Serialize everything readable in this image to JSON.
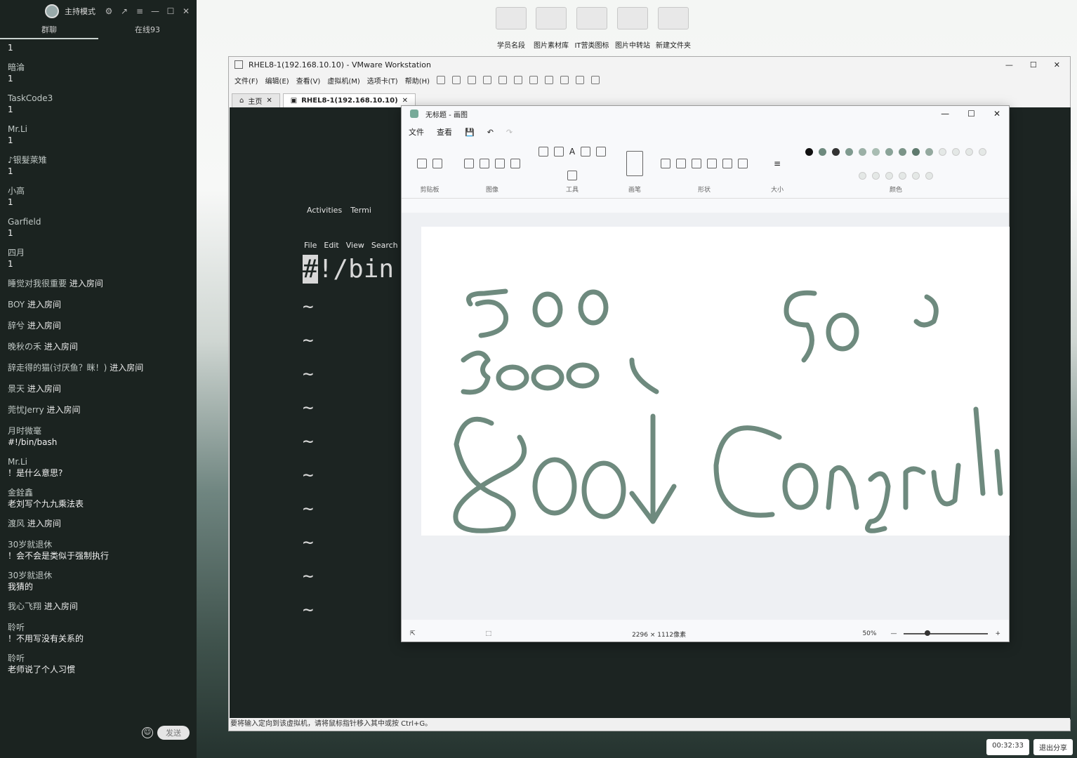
{
  "chat": {
    "mode": "主持模式",
    "tabs": [
      "群聊",
      "在线93"
    ],
    "messages": [
      {
        "who": "",
        "text": "1"
      },
      {
        "who": "暗淪",
        "text": "1"
      },
      {
        "who": "TaskCode3",
        "text": "1"
      },
      {
        "who": "Mr.Li",
        "text": "1"
      },
      {
        "who": "♪银髮萊雉",
        "text": "1"
      },
      {
        "who": "小高",
        "text": "1"
      },
      {
        "who": "Garfield",
        "text": "1"
      },
      {
        "who": "四月",
        "text": "1"
      }
    ],
    "joins": [
      {
        "who": "睡觉对我很重要",
        "action": "进入房间"
      },
      {
        "who": "BOY",
        "action": "进入房间"
      },
      {
        "who": "辞兮",
        "action": "进入房间"
      },
      {
        "who": "晚秋の禾",
        "action": "进入房间"
      },
      {
        "who": "辞走得的猫(讨厌鱼？眯！)",
        "action": "进入房间"
      },
      {
        "who": "景天",
        "action": "进入房间"
      },
      {
        "who": "莞忧Jerry",
        "action": "进入房间"
      }
    ],
    "messages2": [
      {
        "who": "月时微毫",
        "text": "#!/bin/bash"
      },
      {
        "who": "Mr.Li",
        "text": "！是什么意思?"
      },
      {
        "who": "金銓鑫",
        "text": "老刘写个九九乘法表"
      }
    ],
    "join2": {
      "who": "渡风",
      "action": "进入房间"
    },
    "messages3": [
      {
        "who": "30岁就退休",
        "text": "！会不会是类似于强制执行"
      },
      {
        "who": "30岁就退休",
        "text": "我猜的"
      }
    ],
    "join3": {
      "who": "我心飞翔",
      "action": "进入房间"
    },
    "messages4": [
      {
        "who": "聆听",
        "text": "！不用写没有关系的"
      },
      {
        "who": "聆听",
        "text": "老师说了个人习惯"
      }
    ],
    "send_label": "发送"
  },
  "desktop": {
    "shortcuts": [
      "学员名段",
      "图片素材库",
      "IT营类图标",
      "图片中转站",
      "新建文件夹"
    ]
  },
  "vmware": {
    "title": "RHEL8-1(192.168.10.10) - VMware Workstation",
    "menu": [
      "文件(F)",
      "编辑(E)",
      "查看(V)",
      "虚拟机(M)",
      "选项卡(T)",
      "帮助(H)"
    ],
    "tabs": [
      {
        "label": "主页"
      },
      {
        "label": "RHEL8-1(192.168.10.10)"
      }
    ],
    "gnome_activities": "Activities",
    "gnome_terminal": "Termi",
    "term_menu": [
      "File",
      "Edit",
      "View",
      "Search"
    ],
    "bash_line": "!/bin",
    "bash_cursor": "#",
    "tilde_lines": [
      "~",
      "~",
      "~",
      "~",
      "~",
      "~",
      "~",
      "~",
      "~",
      "~"
    ],
    "status_text": "要将输入定向到该虚拟机，请将鼠标指针移入其中或按 Ctrl+G。"
  },
  "paint": {
    "title": "无标题 - 画图",
    "menu": [
      "文件",
      "查看"
    ],
    "groups": [
      "剪贴板",
      "图像",
      "工具",
      "画笔",
      "形状",
      "大小",
      "颜色"
    ],
    "dimensions": "2296 × 1112像素",
    "zoom": "50%",
    "palette": [
      "#111111",
      "#6e8a7e",
      "#333333",
      "#7f9a8f",
      "#9bb0a6",
      "#a9bdb3",
      "#8aa398",
      "#7b9488",
      "#5f7a6e",
      "#94a99f"
    ],
    "accent_stroke": "#6e8a7e"
  },
  "bottombar": {
    "timer": "00:32:33",
    "exit_share": "退出分享"
  }
}
